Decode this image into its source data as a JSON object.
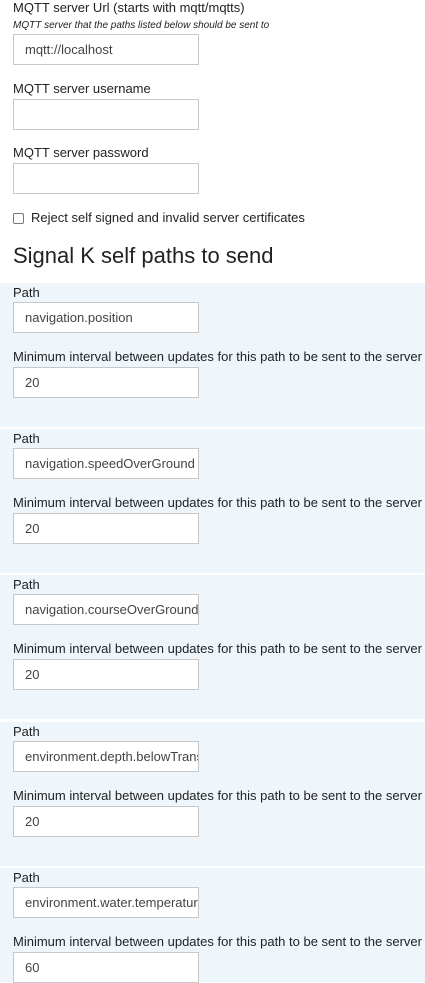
{
  "mqtt": {
    "url_label": "MQTT server Url (starts with mqtt/mqtts)",
    "url_description": "MQTT server that the paths listed below should be sent to",
    "url_value": "mqtt://localhost",
    "username_label": "MQTT server username",
    "username_value": "",
    "password_label": "MQTT server password",
    "password_value": "",
    "reject_label": "Reject self signed and invalid server certificates",
    "reject_checked": false
  },
  "paths_section": {
    "title": "Signal K self paths to send",
    "items": [
      {
        "path_label": "Path",
        "path": "navigation.position",
        "interval_label": "Minimum interval between updates for this path to be sent to the server",
        "interval": "20"
      },
      {
        "path_label": "Path",
        "path": "navigation.speedOverGround",
        "interval_label": "Minimum interval between updates for this path to be sent to the server",
        "interval": "20"
      },
      {
        "path_label": "Path",
        "path": "navigation.courseOverGroundTrue",
        "interval_label": "Minimum interval between updates for this path to be sent to the server",
        "interval": "20"
      },
      {
        "path_label": "Path",
        "path": "environment.depth.belowTransducer",
        "interval_label": "Minimum interval between updates for this path to be sent to the server",
        "interval": "20"
      },
      {
        "path_label": "Path",
        "path": "environment.water.temperature",
        "interval_label": "Minimum interval between updates for this path to be sent to the server",
        "interval": "60"
      }
    ]
  }
}
